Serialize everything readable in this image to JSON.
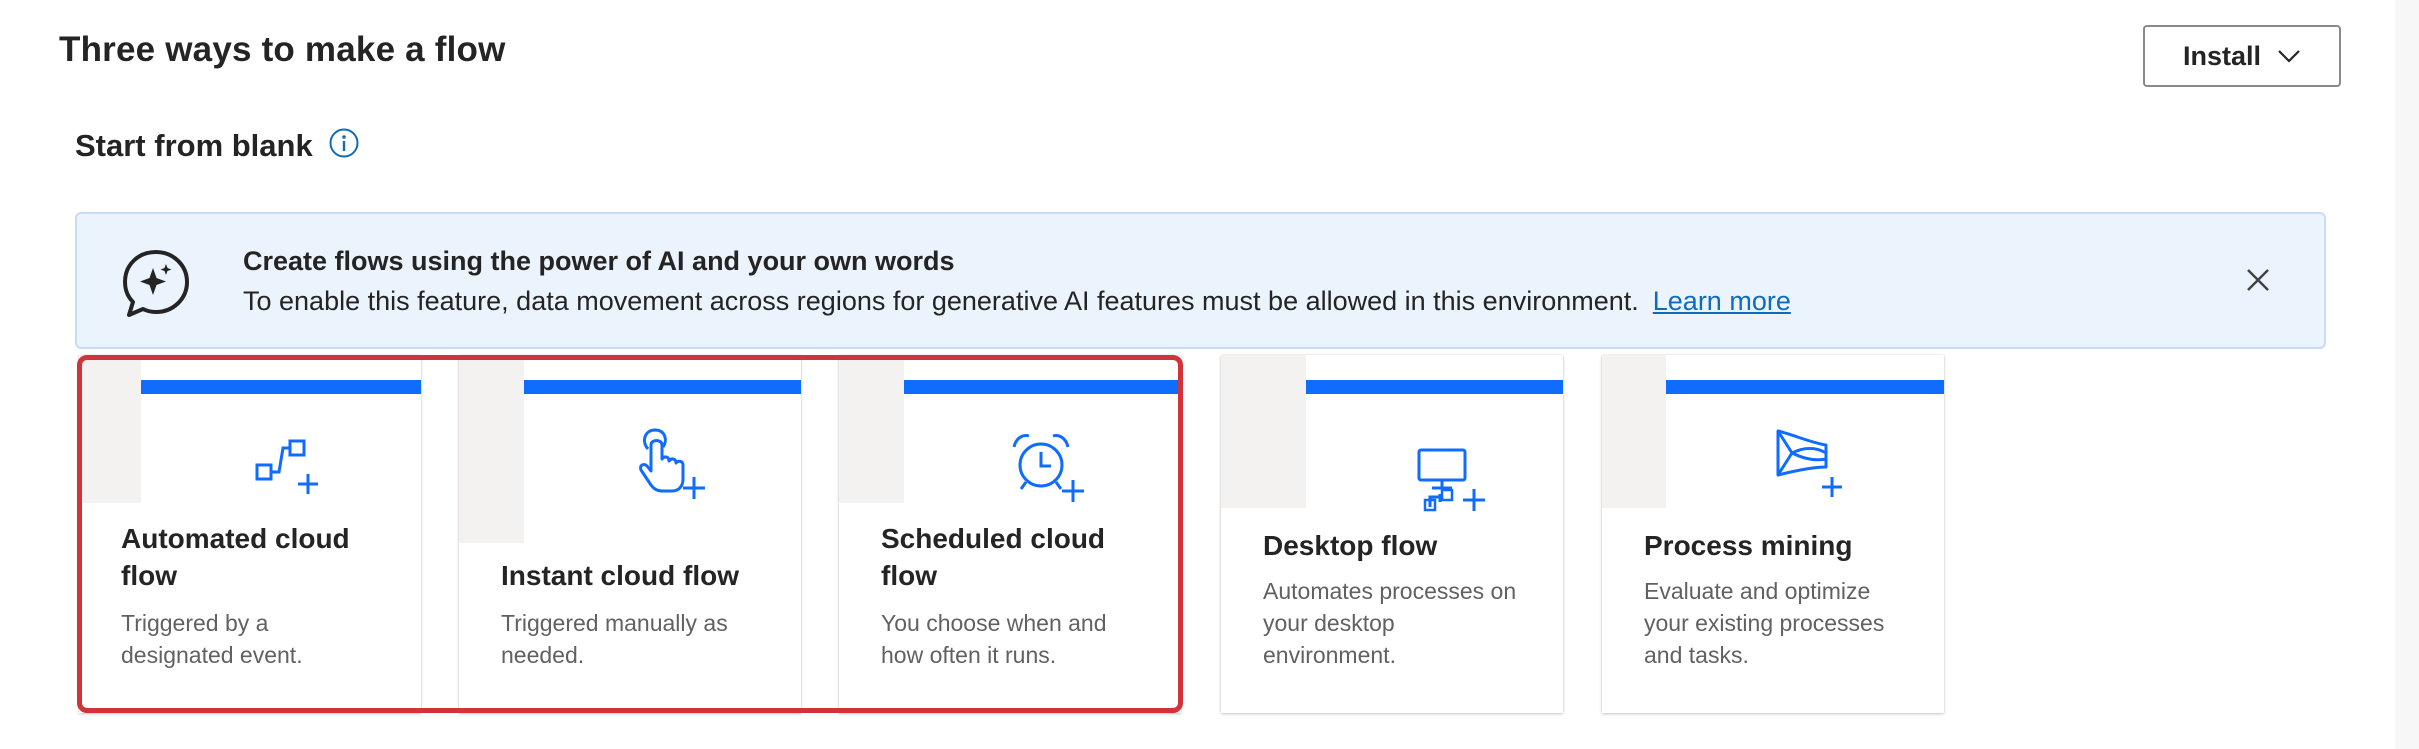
{
  "header": {
    "title": "Three ways to make a flow",
    "install_label": "Install"
  },
  "section": {
    "title": "Start from blank"
  },
  "ai_banner": {
    "heading": "Create flows using the power of AI and your own words",
    "text": "To enable this feature, data movement across regions for generative AI features must be allowed in this environment.",
    "link": "Learn more"
  },
  "cards": [
    {
      "title_line1": "Automated cloud",
      "title_line2": "flow",
      "desc_line1": "Triggered by a",
      "desc_line2": "designated event.",
      "icon": "automated-flow-icon"
    },
    {
      "title_line1": "Instant cloud flow",
      "desc_line1": "Triggered manually as",
      "desc_line2": "needed.",
      "icon": "instant-flow-icon"
    },
    {
      "title_line1": "Scheduled cloud",
      "title_line2": "flow",
      "desc_line1": "You choose when and",
      "desc_line2": "how often it runs.",
      "icon": "scheduled-flow-icon"
    },
    {
      "title_line1": "Desktop flow",
      "desc_line1": "Automates processes on",
      "desc_line2": "your desktop",
      "desc_line3": "environment.",
      "icon": "desktop-flow-icon"
    },
    {
      "title_line1": "Process mining",
      "desc_line1": "Evaluate and optimize",
      "desc_line2": "your existing processes",
      "desc_line3": "and tasks.",
      "icon": "process-mining-icon"
    }
  ],
  "colors": {
    "accent": "#0f6cfd",
    "selection": "#d13438",
    "banner_bg": "#ebf3fc",
    "link": "#0f6cbd"
  }
}
